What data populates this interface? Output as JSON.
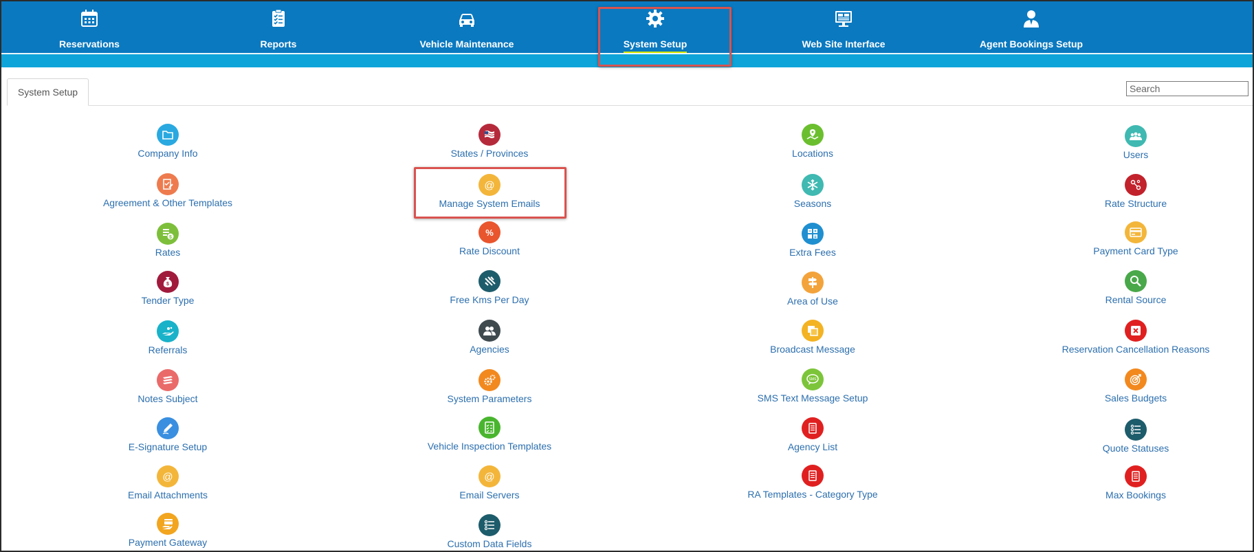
{
  "nav": {
    "items": [
      {
        "label": "Reservations",
        "icon": "calendar-icon"
      },
      {
        "label": "Reports",
        "icon": "clipboard-icon"
      },
      {
        "label": "Vehicle Maintenance",
        "icon": "car-icon"
      },
      {
        "label": "System Setup",
        "icon": "gear-icon",
        "active": true
      },
      {
        "label": "Web Site Interface",
        "icon": "monitor-icon"
      },
      {
        "label": "Agent Bookings Setup",
        "icon": "agent-icon"
      }
    ]
  },
  "tab": {
    "label": "System Setup"
  },
  "search": {
    "placeholder": "Search"
  },
  "colors": {
    "nav_bg": "#0a79c0",
    "subbar": "#0fa4d9",
    "link": "#2c6fae",
    "highlight": "#d9534f"
  },
  "columns": [
    [
      {
        "label": "Company Info",
        "icon": "folder-icon",
        "color": "#2aa9e0"
      },
      {
        "label": "Agreement & Other Templates",
        "icon": "document-edit-icon",
        "color": "#ee7b4e"
      },
      {
        "label": "Rates",
        "icon": "rates-dollar-icon",
        "color": "#7dbf3b"
      },
      {
        "label": "Tender Type",
        "icon": "money-bag-icon",
        "color": "#a01a3c"
      },
      {
        "label": "Referrals",
        "icon": "hand-icon",
        "color": "#19b2c9"
      },
      {
        "label": "Notes Subject",
        "icon": "notes-stack-icon",
        "color": "#ea6a6a"
      },
      {
        "label": "E-Signature Setup",
        "icon": "pen-icon",
        "color": "#3a8fe0"
      },
      {
        "label": "Email Attachments",
        "icon": "at-sign-icon",
        "color": "#f3b63b"
      },
      {
        "label": "Payment Gateway",
        "icon": "payment-card-hand-icon",
        "color": "#f2a51f"
      }
    ],
    [
      {
        "label": "States / Provinces",
        "icon": "flag-icon",
        "color": "#b52a3b"
      },
      {
        "label": "Manage System Emails",
        "icon": "at-sign-icon",
        "color": "#f3b63b"
      },
      {
        "label": "Rate Discount",
        "icon": "percent-icon",
        "color": "#e9552d"
      },
      {
        "label": "Free Kms Per Day",
        "icon": "road-icon",
        "color": "#1d5c6b"
      },
      {
        "label": "Agencies",
        "icon": "people-icon",
        "color": "#3f4a4f"
      },
      {
        "label": "System Parameters",
        "icon": "gears-icon",
        "color": "#f2891f"
      },
      {
        "label": "Vehicle Inspection Templates",
        "icon": "checklist-icon",
        "color": "#49b52f"
      },
      {
        "label": "Email Servers",
        "icon": "at-sign-icon",
        "color": "#f3b63b"
      },
      {
        "label": "Custom Data Fields",
        "icon": "list-icon",
        "color": "#1d5c6b"
      }
    ],
    [
      {
        "label": "Locations",
        "icon": "map-pin-icon",
        "color": "#6bbf2f"
      },
      {
        "label": "Seasons",
        "icon": "snowflake-icon",
        "color": "#3fb9b1"
      },
      {
        "label": "Extra Fees",
        "icon": "calculator-icon",
        "color": "#1f8fd0"
      },
      {
        "label": "Area of Use",
        "icon": "signpost-icon",
        "color": "#f3a33b"
      },
      {
        "label": "Broadcast Message",
        "icon": "copy-icon",
        "color": "#f3b323"
      },
      {
        "label": "SMS Text Message Setup",
        "icon": "sms-bubble-icon",
        "color": "#7cc53a"
      },
      {
        "label": "Agency List",
        "icon": "document-list-icon",
        "color": "#e02020"
      },
      {
        "label": "RA Templates - Category Type",
        "icon": "document-list-icon",
        "color": "#e02020"
      }
    ],
    [
      {
        "label": "Users",
        "icon": "users-group-icon",
        "color": "#3fb9b1"
      },
      {
        "label": "Rate Structure",
        "icon": "share-nodes-icon",
        "color": "#c2222c"
      },
      {
        "label": "Payment Card Type",
        "icon": "credit-card-icon",
        "color": "#f3b63b"
      },
      {
        "label": "Rental Source",
        "icon": "magnifier-icon",
        "color": "#49a84a"
      },
      {
        "label": "Reservation Cancellation Reasons",
        "icon": "cancel-box-icon",
        "color": "#e02020"
      },
      {
        "label": "Sales Budgets",
        "icon": "target-icon",
        "color": "#f2891f"
      },
      {
        "label": "Quote Statuses",
        "icon": "list-icon",
        "color": "#1d5c6b"
      },
      {
        "label": "Max Bookings",
        "icon": "document-list-icon",
        "color": "#e02020"
      }
    ]
  ]
}
